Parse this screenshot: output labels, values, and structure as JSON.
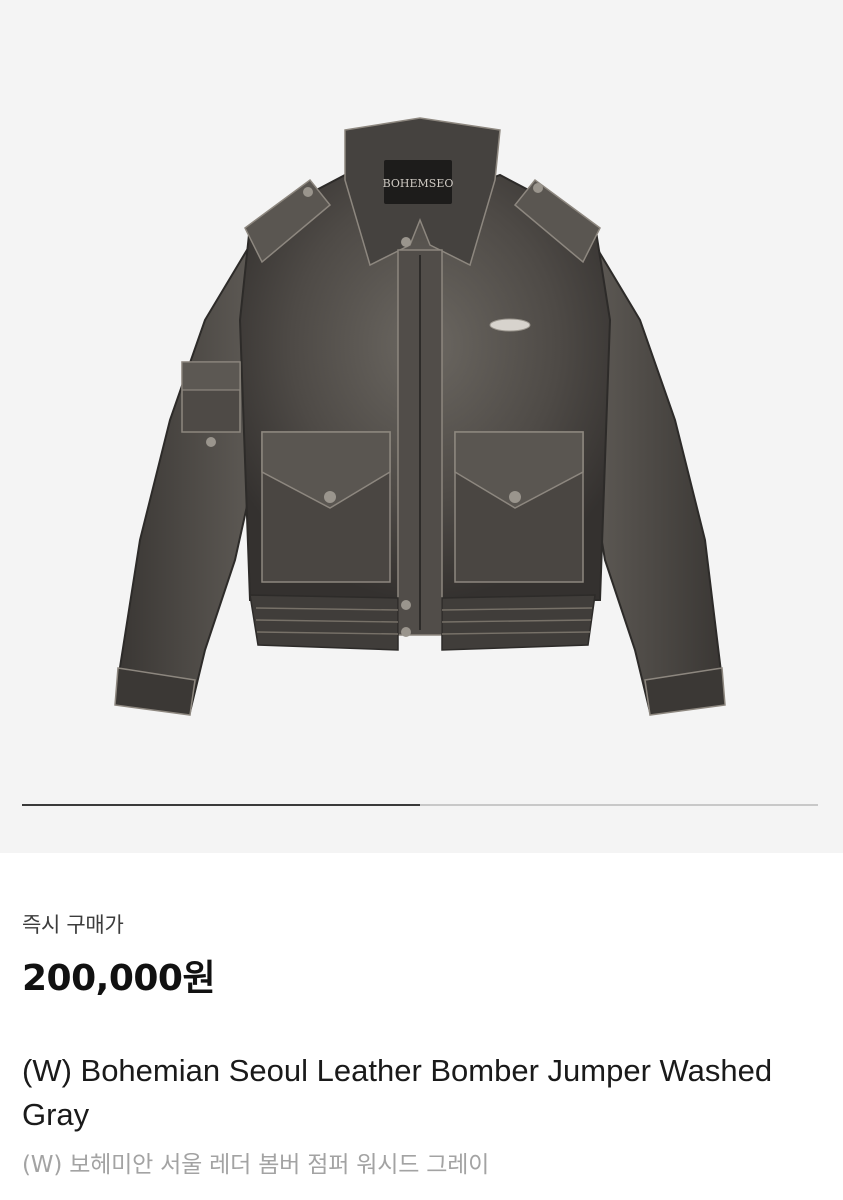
{
  "product": {
    "image_alt": "BOHEMSEO",
    "carousel": {
      "current_progress": 0.5
    },
    "price_label": "즉시 구매가",
    "price": "200,000원",
    "title_en": "(W) Bohemian Seoul Leather Bomber Jumper Washed Gray",
    "title_ko": "(W) 보헤미안 서울 레더 봄버 점퍼 워시드 그레이"
  },
  "colors": {
    "hero_bg": "#f4f4f4",
    "jacket_base": "#4a4744",
    "indicator_active": "#3a3a3a",
    "indicator_track": "#c8c8c8",
    "subtitle": "#a3a3a3"
  }
}
